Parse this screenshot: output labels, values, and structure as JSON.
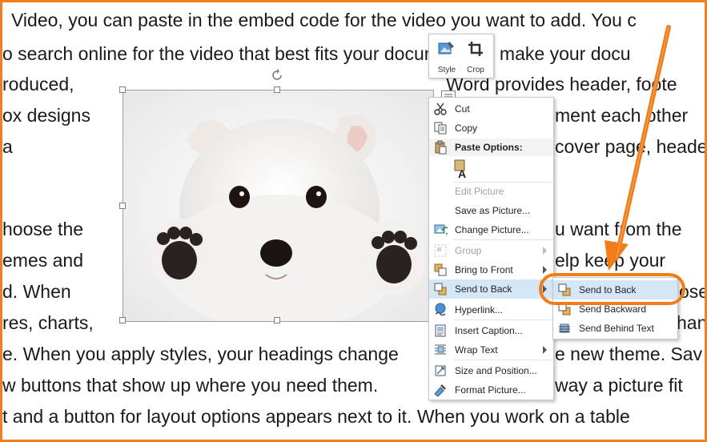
{
  "document": {
    "lines": [
      "Video, you can paste in the embed code for the video you want to add. You c",
      "o search online for the video that best fits your document. To make your docu",
      "roduced,",
      "Word provides header, foote",
      "ox designs",
      "ment each other",
      "a",
      "cover page, heade",
      "hoose the",
      "u want from the",
      "emes and",
      "elp keep your",
      "d. When",
      "ose",
      "res, charts,",
      "hang",
      "e. When you apply styles, your headings change",
      "e new theme. Sav",
      "w buttons that show up where you need them.",
      "way a picture fit",
      "t and a button for layout options appears next to it. When you work on a table"
    ]
  },
  "picture_toolbar": {
    "style_label": "Style",
    "crop_label": "Crop"
  },
  "context_menu": {
    "cut": "Cut",
    "copy": "Copy",
    "paste_options": "Paste Options:",
    "edit_picture": "Edit Picture",
    "save_as_picture": "Save as Picture...",
    "change_picture": "Change Picture...",
    "group": "Group",
    "bring_to_front": "Bring to Front",
    "send_to_back": "Send to Back",
    "hyperlink": "Hyperlink...",
    "insert_caption": "Insert Caption...",
    "wrap_text": "Wrap Text",
    "size_and_position": "Size and Position...",
    "format_picture": "Format Picture..."
  },
  "submenu": {
    "send_to_back": "Send to Back",
    "send_backward": "Send Backward",
    "send_behind_text": "Send Behind Text"
  },
  "colors": {
    "annotation_orange": "#f07d18",
    "menu_highlight": "#d5e6f7"
  }
}
